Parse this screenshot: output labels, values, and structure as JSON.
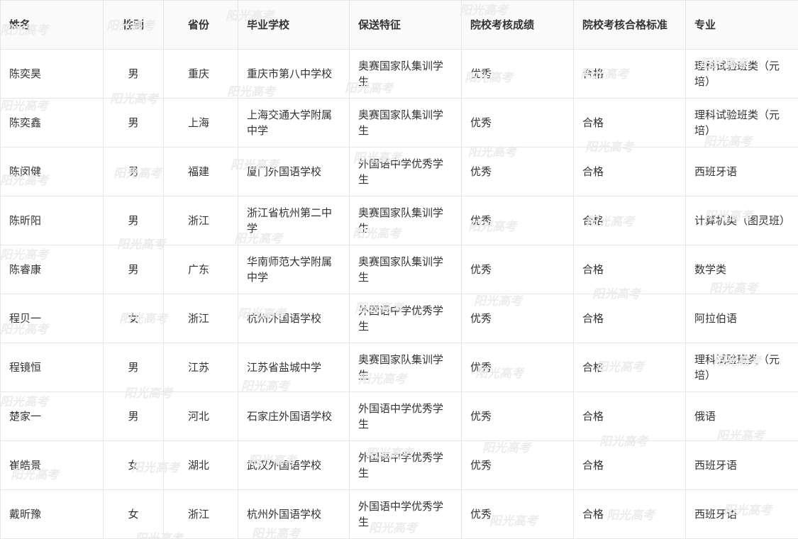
{
  "table": {
    "headers": [
      "姓名",
      "性别",
      "省份",
      "毕业学校",
      "保送特征",
      "院校考核成绩",
      "院校考核合格标准",
      "专业"
    ],
    "rows": [
      [
        "陈奕昊",
        "男",
        "重庆",
        "重庆市第八中学校",
        "奥赛国家队集训学生",
        "优秀",
        "合格",
        "理科试验班类（元培）"
      ],
      [
        "陈奕鑫",
        "男",
        "上海",
        "上海交通大学附属中学",
        "奥赛国家队集训学生",
        "优秀",
        "合格",
        "理科试验班类（元培）"
      ],
      [
        "陈闵健",
        "男",
        "福建",
        "厦门外国语学校",
        "外国语中学优秀学生",
        "优秀",
        "合格",
        "西班牙语"
      ],
      [
        "陈昕阳",
        "男",
        "浙江",
        "浙江省杭州第二中学",
        "奥赛国家队集训学生",
        "优秀",
        "合格",
        "计算机类（图灵班）"
      ],
      [
        "陈睿康",
        "男",
        "广东",
        "华南师范大学附属中学",
        "奥赛国家队集训学生",
        "优秀",
        "合格",
        "数学类"
      ],
      [
        "程贝一",
        "女",
        "浙江",
        "杭州外国语学校",
        "外国语中学优秀学生",
        "优秀",
        "合格",
        "阿拉伯语"
      ],
      [
        "程镜恒",
        "男",
        "江苏",
        "江苏省盐城中学",
        "奥赛国家队集训学生",
        "优秀",
        "合格",
        "理科试验班类（元培）"
      ],
      [
        "楚家一",
        "男",
        "河北",
        "石家庄外国语学校",
        "外国语中学优秀学生",
        "优秀",
        "合格",
        "俄语"
      ],
      [
        "崔皓景",
        "女",
        "湖北",
        "武汉外国语学校",
        "外国语中学优秀学生",
        "优秀",
        "合格",
        "西班牙语"
      ],
      [
        "戴昕豫",
        "女",
        "浙江",
        "杭州外国语学校",
        "外国语中学优秀学生",
        "优秀",
        "合格",
        "西班牙语"
      ]
    ]
  },
  "watermark": {
    "text": "阳光高考",
    "color": "#ececec"
  }
}
